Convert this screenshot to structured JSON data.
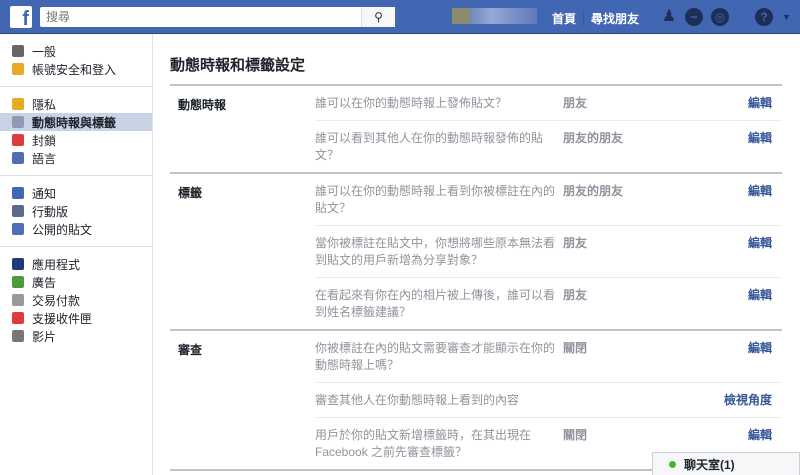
{
  "header": {
    "search_placeholder": "搜尋",
    "nav": [
      "首頁",
      "尋找朋友"
    ]
  },
  "sidebar": {
    "groups": [
      [
        {
          "label": "一般",
          "icon": "gears-icon",
          "color": "#666"
        },
        {
          "label": "帳號安全和登入",
          "icon": "shield-icon",
          "color": "#e8a925"
        }
      ],
      [
        {
          "label": "隱私",
          "icon": "lock-icon",
          "color": "#e8a925"
        },
        {
          "label": "動態時報與標籤",
          "icon": "timeline-icon",
          "color": "#8d9bb5",
          "active": true
        },
        {
          "label": "封鎖",
          "icon": "block-icon",
          "color": "#dd3c3c"
        },
        {
          "label": "語言",
          "icon": "language-icon",
          "color": "#4f6eb5"
        }
      ],
      [
        {
          "label": "通知",
          "icon": "globe-icon",
          "color": "#4267b2"
        },
        {
          "label": "行動版",
          "icon": "mobile-icon",
          "color": "#5d6b8a"
        },
        {
          "label": "公開的貼文",
          "icon": "rss-icon",
          "color": "#4f6eb5"
        }
      ],
      [
        {
          "label": "應用程式",
          "icon": "apps-icon",
          "color": "#1d3a7a"
        },
        {
          "label": "廣告",
          "icon": "ads-icon",
          "color": "#4e9a3a"
        },
        {
          "label": "交易付款",
          "icon": "card-icon",
          "color": "#999"
        },
        {
          "label": "支援收件匣",
          "icon": "lifebuoy-icon",
          "color": "#dd3c3c"
        },
        {
          "label": "影片",
          "icon": "film-icon",
          "color": "#777"
        }
      ]
    ]
  },
  "main": {
    "title": "動態時報和標籤設定",
    "sections": [
      {
        "heading": "動態時報",
        "rows": [
          {
            "q": "誰可以在你的動態時報上發佈貼文？",
            "v": "朋友",
            "e": "編輯"
          },
          {
            "q": "誰可以看到其他人在你的動態時報發佈的貼文？",
            "v": "朋友的朋友",
            "e": "編輯"
          }
        ]
      },
      {
        "heading": "標籤",
        "rows": [
          {
            "q": "誰可以在你的動態時報上看到你被標註在內的貼文？",
            "v": "朋友的朋友",
            "e": "編輯"
          },
          {
            "q": "當你被標註在貼文中，你想將哪些原本無法看到貼文的用戶新增為分享對象？",
            "v": "朋友",
            "e": "編輯"
          },
          {
            "q": "在看起來有你在內的相片被上傳後，誰可以看到姓名標籤建議？",
            "v": "朋友",
            "e": "編輯"
          }
        ]
      },
      {
        "heading": "審查",
        "rows": [
          {
            "q": "你被標註在內的貼文需要審查才能顯示在你的動態時報上嗎？",
            "v": "關閉",
            "e": "編輯"
          },
          {
            "q": "審查其他人在你動態時報上看到的內容",
            "v": "",
            "e": "檢視角度"
          },
          {
            "q": "用戶於你的貼文新增標籤時，在其出現在 Facebook 之前先審查標籤？",
            "v": "關閉",
            "e": "編輯"
          }
        ]
      }
    ]
  },
  "chat": {
    "label": "聊天室(1)"
  }
}
